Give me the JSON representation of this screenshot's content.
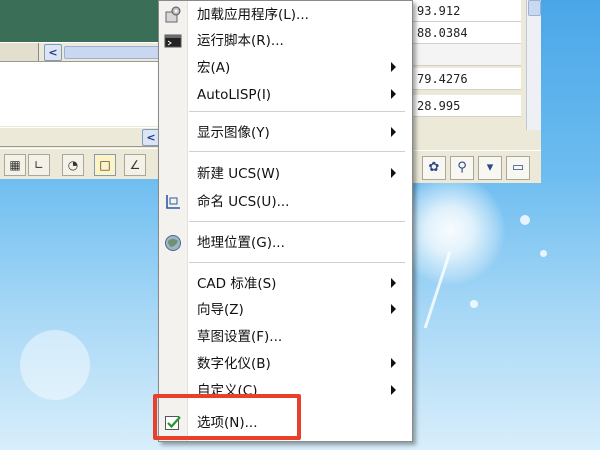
{
  "values": [
    "93.912",
    "88.0384",
    "79.4276",
    "28.995"
  ],
  "menu": {
    "items": [
      {
        "label": "加载应用程序(L)..."
      },
      {
        "label": "运行脚本(R)..."
      },
      {
        "label": "宏(A)"
      },
      {
        "label": "AutoLISP(I)"
      },
      {
        "label": "显示图像(Y)"
      },
      {
        "label": "新建 UCS(W)"
      },
      {
        "label": "命名 UCS(U)..."
      },
      {
        "label": "地理位置(G)..."
      },
      {
        "label": "CAD 标准(S)"
      },
      {
        "label": "向导(Z)"
      },
      {
        "label": "草图设置(F)..."
      },
      {
        "label": "数字化仪(B)"
      },
      {
        "label": "自定义(C)"
      },
      {
        "label": "选项(N)..."
      }
    ]
  },
  "colors": {
    "highlight": "#e8402a",
    "menu_bg": "#ffffff"
  },
  "icons": {
    "load_app": "gear-puzzle-icon",
    "run_script": "terminal-icon",
    "named_ucs": "ucs-axis-icon",
    "geo_location": "globe-icon",
    "options": "checkbox-checked-icon"
  }
}
